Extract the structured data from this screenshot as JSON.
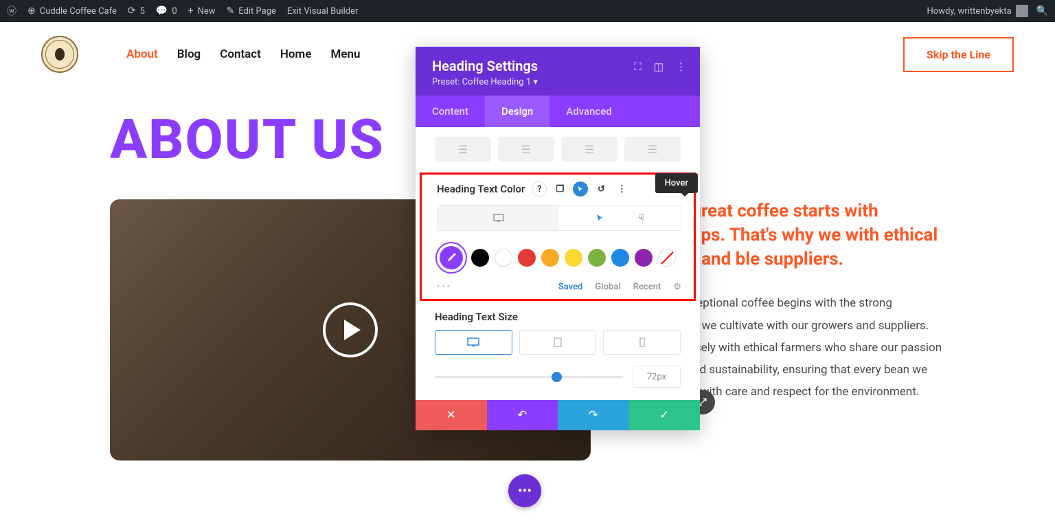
{
  "wp_bar": {
    "site_name": "Cuddle Coffee Cafe",
    "updates": "5",
    "comments": "0",
    "new": "New",
    "edit": "Edit Page",
    "exit": "Exit Visual Builder",
    "howdy": "Howdy, writtenbyekta"
  },
  "nav": {
    "items": [
      "About",
      "Blog",
      "Contact",
      "Home",
      "Menu"
    ],
    "cta": "Skip the Line"
  },
  "page": {
    "heading": "ABOUT US",
    "tagline": "ve that great coffee starts with lationships. That's why we with ethical growers and ble suppliers.",
    "body": "tment to exceptional coffee begins with the strong relationships we cultivate with our growers and suppliers. We work closely with ethical farmers who share our passion for quality and sustainability, ensuring that every bean we use is grown with care and respect for the environment."
  },
  "panel": {
    "title": "Heading Settings",
    "preset": "Preset: Coffee Heading 1 ▾",
    "tabs": {
      "content": "Content",
      "design": "Design",
      "advanced": "Advanced"
    },
    "color_label": "Heading Text Color",
    "hover_tooltip": "Hover",
    "swatches": [
      "#000000",
      "#ffffff",
      "#e53935",
      "#f9a825",
      "#fdd835",
      "#7cb342",
      "#1e88e5",
      "#8e24aa"
    ],
    "meta": {
      "saved": "Saved",
      "global": "Global",
      "recent": "Recent"
    },
    "size_label": "Heading Text Size",
    "size_value": "72px"
  }
}
